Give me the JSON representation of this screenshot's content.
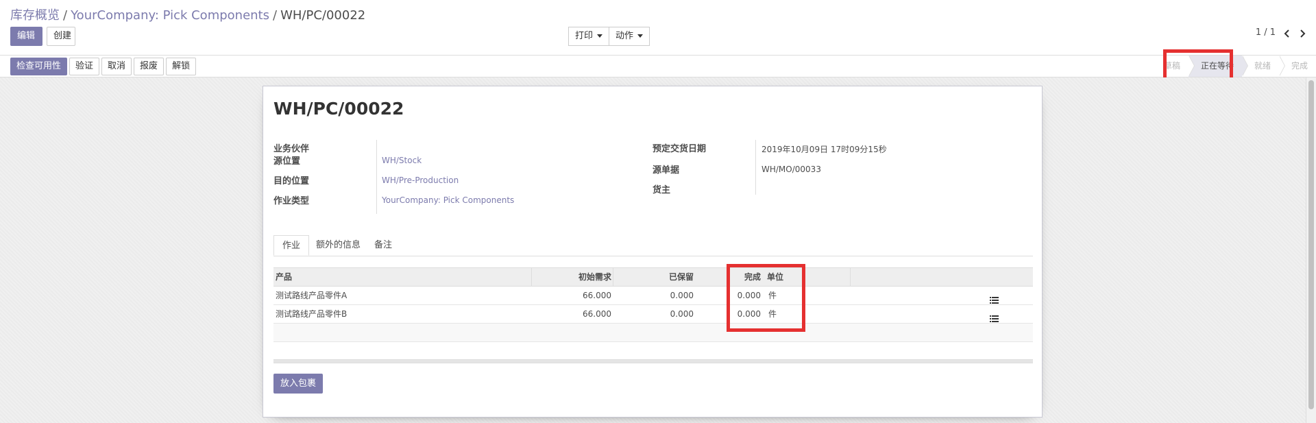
{
  "breadcrumb": {
    "item1": "库存概览",
    "sep1": "/",
    "item2": "YourCompany: Pick Components",
    "sep2": "/",
    "current": "WH/PC/00022"
  },
  "toolbar": {
    "edit_label": "编辑",
    "create_label": "创建",
    "print_label": "打印",
    "action_label": "动作"
  },
  "pager": {
    "value": "1 / 1"
  },
  "status_actions": [
    "检查可用性",
    "验证",
    "取消",
    "报废",
    "解锁"
  ],
  "stages": [
    "草稿",
    "正在等待",
    "就绪",
    "完成"
  ],
  "active_stage": "正在等待",
  "form": {
    "title": "WH/PC/00022",
    "left": {
      "partner_label": "业务伙伴",
      "source_label": "源位置",
      "source_value": "WH/Stock",
      "dest_label": "目的位置",
      "dest_value": "WH/Pre-Production",
      "optype_label": "作业类型",
      "optype_value": "YourCompany: Pick Components"
    },
    "right": {
      "date_label": "预定交货日期",
      "date_value": "2019年10月09日 17时09分15秒",
      "origin_label": "源单据",
      "origin_value": "WH/MO/00033",
      "owner_label": "货主"
    }
  },
  "tabs": [
    "作业",
    "额外的信息",
    "备注"
  ],
  "table": {
    "headers": {
      "product": "产品",
      "initial_demand": "初始需求",
      "reserved": "已保留",
      "done": "完成",
      "uom": "单位"
    },
    "rows": [
      {
        "product": "测试路线产品零件A",
        "initial_demand": "66.000",
        "reserved": "0.000",
        "done": "0.000",
        "uom": "件"
      },
      {
        "product": "测试路线产品零件B",
        "initial_demand": "66.000",
        "reserved": "0.000",
        "done": "0.000",
        "uom": "件"
      }
    ]
  },
  "pack_button_label": "放入包裹",
  "colors": {
    "brand": "#7c7bad",
    "highlight": "#e53030",
    "active_stage_bg": "#e6e6ee"
  }
}
